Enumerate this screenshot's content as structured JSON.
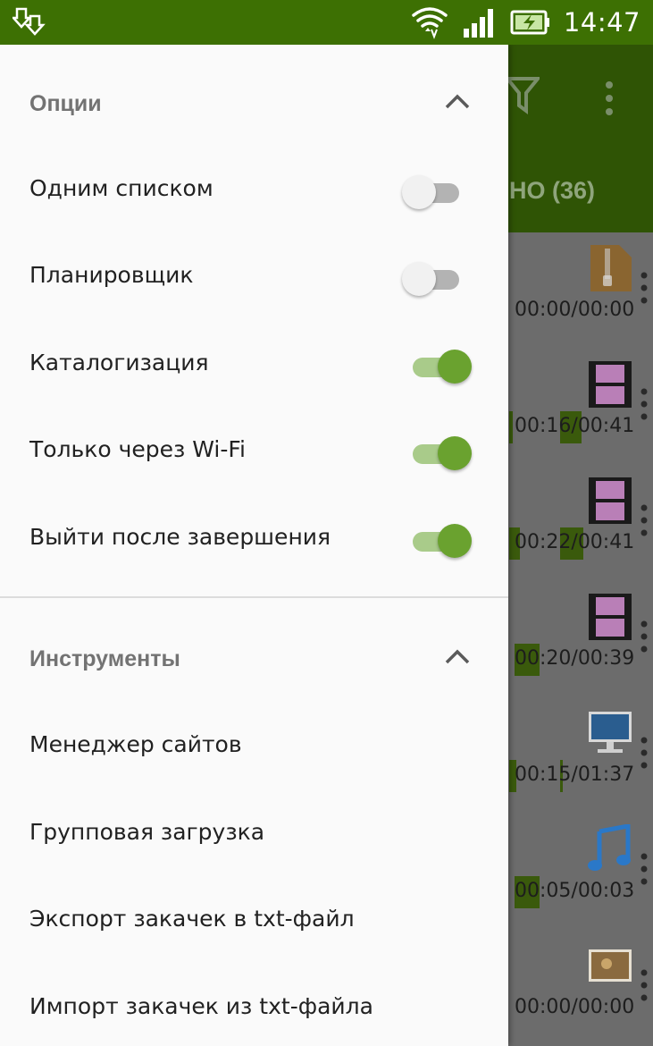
{
  "status_bar": {
    "time": "14:47"
  },
  "drawer": {
    "options": {
      "title": "Опции",
      "items": [
        {
          "label": "Одним списком",
          "on": false
        },
        {
          "label": "Планировщик",
          "on": false
        },
        {
          "label": "Каталогизация",
          "on": true
        },
        {
          "label": "Только через Wi-Fi",
          "on": true
        },
        {
          "label": "Выйти после завершения",
          "on": true
        }
      ]
    },
    "tools": {
      "title": "Инструменты",
      "items": [
        {
          "label": "Менеджер сайтов"
        },
        {
          "label": "Групповая загрузка"
        },
        {
          "label": "Экспорт закачек в txt-файл"
        },
        {
          "label": "Импорт закачек из txt-файла"
        }
      ]
    }
  },
  "background": {
    "tab_text": "НО (36)",
    "items": [
      {
        "icon": "archive-icon",
        "time": "00:00/00:00"
      },
      {
        "icon": "video-icon",
        "time": "00:16/00:41"
      },
      {
        "icon": "video-icon",
        "time": "00:22/00:41"
      },
      {
        "icon": "video-icon",
        "time": "00:20/00:39"
      },
      {
        "icon": "monitor-icon",
        "time": "00:15/01:37"
      },
      {
        "icon": "music-icon",
        "time": "00:05/00:03"
      },
      {
        "icon": "image-icon",
        "time": "00:00/00:00"
      }
    ]
  },
  "colors": {
    "status_bar": "#3d7003",
    "accent": "#6aa22f",
    "toolbar_dim": "#2f5405"
  }
}
